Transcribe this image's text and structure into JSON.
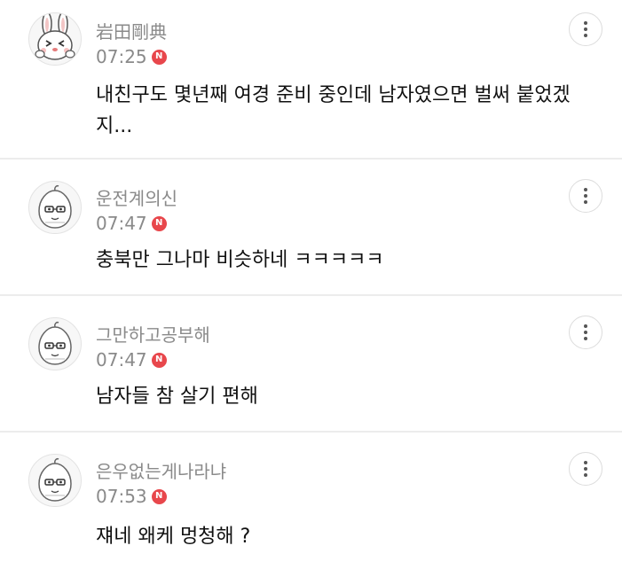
{
  "comments": [
    {
      "nickname": "岩田剛典",
      "time": "07:25",
      "badge": "N",
      "avatar": "rabbit-character-avatar",
      "text": "내친구도 몇년째 여경 준비 중인데 남자였으면 벌써 붙었겠지..."
    },
    {
      "nickname": "운전계의신",
      "time": "07:47",
      "badge": "N",
      "avatar": "default-character-avatar",
      "text": "충북만 그나마 비슷하네 ㅋㅋㅋㅋㅋ"
    },
    {
      "nickname": "그만하고공부해",
      "time": "07:47",
      "badge": "N",
      "avatar": "default-character-avatar",
      "text": "남자들 참 살기 편해"
    },
    {
      "nickname": "은우없는게나라냐",
      "time": "07:53",
      "badge": "N",
      "avatar": "default-character-avatar",
      "text": "쟤네 왜케 멍청해 ?"
    }
  ],
  "colors": {
    "badge": "#e8474c",
    "meta_text": "#8a8a8a",
    "divider": "#ececec"
  }
}
